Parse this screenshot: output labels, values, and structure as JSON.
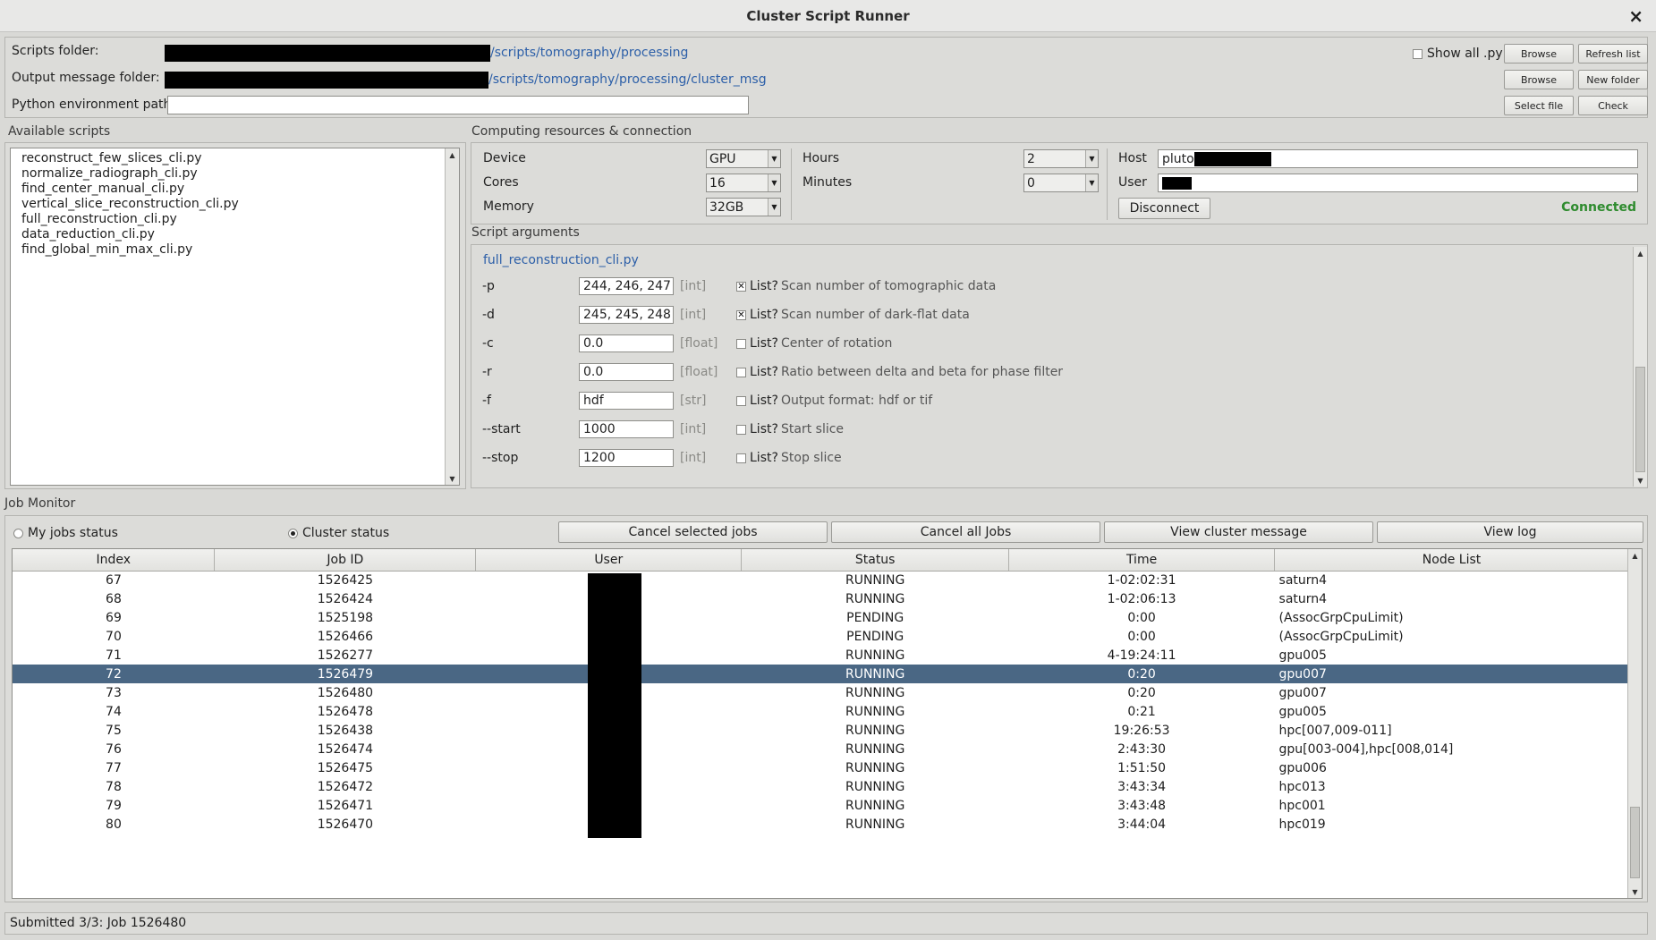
{
  "window": {
    "title": "Cluster Script Runner",
    "close_glyph": "×"
  },
  "paths": {
    "scripts_folder_label": "Scripts folder:",
    "scripts_folder_value": "/scripts/tomography/processing",
    "output_folder_label": "Output message folder:",
    "output_folder_value": "/scripts/tomography/processing/cluster_msg",
    "python_env_label": "Python environment path:",
    "python_env_value": "",
    "show_all_label": "Show all .py",
    "show_all_checked": false,
    "browse_label": "Browse",
    "refresh_label": "Refresh list",
    "browse2_label": "Browse",
    "new_folder_label": "New folder",
    "select_file_label": "Select file",
    "check_label": "Check"
  },
  "scripts": {
    "section_label": "Available scripts",
    "items": [
      "reconstruct_few_slices_cli.py",
      "normalize_radiograph_cli.py",
      "find_center_manual_cli.py",
      "vertical_slice_reconstruction_cli.py",
      "full_reconstruction_cli.py",
      "data_reduction_cli.py",
      "find_global_min_max_cli.py"
    ]
  },
  "resources": {
    "section_label": "Computing resources & connection",
    "device_label": "Device",
    "device_value": "GPU",
    "cores_label": "Cores",
    "cores_value": "16",
    "memory_label": "Memory",
    "memory_value": "32GB",
    "hours_label": "Hours",
    "hours_value": "2",
    "minutes_label": "Minutes",
    "minutes_value": "0",
    "host_label": "Host",
    "host_value": "pluto",
    "user_label": "User",
    "user_value": "",
    "disconnect_label": "Disconnect",
    "connection_status": "Connected",
    "connection_color": "#2e8b2e"
  },
  "arguments": {
    "section_label": "Script arguments",
    "script_name": "full_reconstruction_cli.py",
    "list_label": "List?",
    "check_glyph": "✕",
    "rows": [
      {
        "name": "-p",
        "value": "244, 246, 247",
        "type": "[int]",
        "list": true,
        "desc": "Scan number of tomographic data"
      },
      {
        "name": "-d",
        "value": "245, 245, 248",
        "type": "[int]",
        "list": true,
        "desc": "Scan number of dark-flat data"
      },
      {
        "name": "-c",
        "value": "0.0",
        "type": "[float]",
        "list": false,
        "desc": "Center of rotation"
      },
      {
        "name": "-r",
        "value": "0.0",
        "type": "[float]",
        "list": false,
        "desc": "Ratio between delta and beta for phase filter"
      },
      {
        "name": "-f",
        "value": "hdf",
        "type": "[str]",
        "list": false,
        "desc": "Output format: hdf or tif"
      },
      {
        "name": "--start",
        "value": "1000",
        "type": "[int]",
        "list": false,
        "desc": "Start slice"
      },
      {
        "name": "--stop",
        "value": "1200",
        "type": "[int]",
        "list": false,
        "desc": "Stop slice"
      }
    ]
  },
  "monitor": {
    "section_label": "Job Monitor",
    "my_jobs_label": "My jobs status",
    "cluster_status_label": "Cluster status",
    "selected_mode": "cluster",
    "cancel_selected_label": "Cancel selected jobs",
    "cancel_all_label": "Cancel all Jobs",
    "view_cluster_msg_label": "View cluster message",
    "view_log_label": "View log",
    "columns": [
      "Index",
      "Job ID",
      "User",
      "Status",
      "Time",
      "Node List"
    ],
    "selected_index": "72",
    "rows": [
      {
        "index": "67",
        "job_id": "1526425",
        "status": "RUNNING",
        "time": "1-02:02:31",
        "nodes": "saturn4"
      },
      {
        "index": "68",
        "job_id": "1526424",
        "status": "RUNNING",
        "time": "1-02:06:13",
        "nodes": "saturn4"
      },
      {
        "index": "69",
        "job_id": "1525198",
        "status": "PENDING",
        "time": "0:00",
        "nodes": "(AssocGrpCpuLimit)"
      },
      {
        "index": "70",
        "job_id": "1526466",
        "status": "PENDING",
        "time": "0:00",
        "nodes": "(AssocGrpCpuLimit)"
      },
      {
        "index": "71",
        "job_id": "1526277",
        "status": "RUNNING",
        "time": "4-19:24:11",
        "nodes": "gpu005"
      },
      {
        "index": "72",
        "job_id": "1526479",
        "status": "RUNNING",
        "time": "0:20",
        "nodes": "gpu007"
      },
      {
        "index": "73",
        "job_id": "1526480",
        "status": "RUNNING",
        "time": "0:20",
        "nodes": "gpu007"
      },
      {
        "index": "74",
        "job_id": "1526478",
        "status": "RUNNING",
        "time": "0:21",
        "nodes": "gpu005"
      },
      {
        "index": "75",
        "job_id": "1526438",
        "status": "RUNNING",
        "time": "19:26:53",
        "nodes": "hpc[007,009-011]"
      },
      {
        "index": "76",
        "job_id": "1526474",
        "status": "RUNNING",
        "time": "2:43:30",
        "nodes": "gpu[003-004],hpc[008,014]"
      },
      {
        "index": "77",
        "job_id": "1526475",
        "status": "RUNNING",
        "time": "1:51:50",
        "nodes": "gpu006"
      },
      {
        "index": "78",
        "job_id": "1526472",
        "status": "RUNNING",
        "time": "3:43:34",
        "nodes": "hpc013"
      },
      {
        "index": "79",
        "job_id": "1526471",
        "status": "RUNNING",
        "time": "3:43:48",
        "nodes": "hpc001"
      },
      {
        "index": "80",
        "job_id": "1526470",
        "status": "RUNNING",
        "time": "3:44:04",
        "nodes": "hpc019"
      }
    ]
  },
  "statusbar": {
    "text": "Submitted 3/3: Job 1526480"
  },
  "icons": {
    "up_arrow": "▲",
    "down_arrow": "▼"
  }
}
